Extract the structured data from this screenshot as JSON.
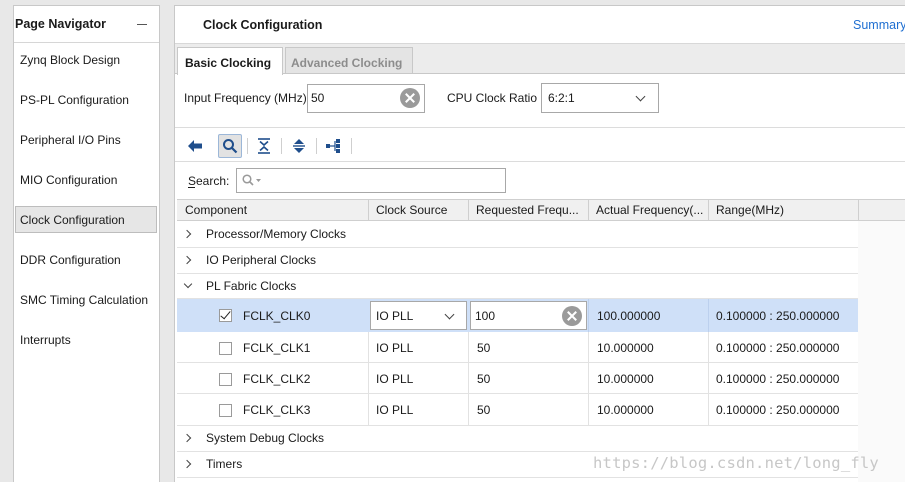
{
  "navigator": {
    "title": "Page Navigator",
    "items": [
      {
        "label": "Zynq Block Design"
      },
      {
        "label": "PS-PL Configuration"
      },
      {
        "label": "Peripheral I/O Pins"
      },
      {
        "label": "MIO Configuration"
      },
      {
        "label": "Clock Configuration",
        "selected": true
      },
      {
        "label": "DDR Configuration"
      },
      {
        "label": "SMC Timing Calculation"
      },
      {
        "label": "Interrupts"
      }
    ]
  },
  "main": {
    "title": "Clock Configuration",
    "summary_link": "Summary",
    "tabs": [
      {
        "label": "Basic Clocking",
        "active": true
      },
      {
        "label": "Advanced Clocking",
        "active": false
      }
    ],
    "input_frequency": {
      "label": "Input Frequency (MHz)",
      "value": "50"
    },
    "cpu_clock_ratio": {
      "label": "CPU Clock Ratio",
      "value": "6:2:1"
    },
    "search": {
      "label": "Search:",
      "placeholder": ""
    },
    "table": {
      "columns": [
        "Component",
        "Clock Source",
        "Requested Frequ...",
        "Actual Frequency(...",
        "Range(MHz)"
      ],
      "groups_top": [
        {
          "label": "Processor/Memory Clocks",
          "expanded": false
        },
        {
          "label": "IO Peripheral Clocks",
          "expanded": false
        },
        {
          "label": "PL Fabric Clocks",
          "expanded": true
        }
      ],
      "rows": [
        {
          "name": "FCLK_CLK0",
          "checked": true,
          "source": "IO PLL",
          "requested": "100",
          "actual": "100.000000",
          "range": "0.100000 : 250.000000"
        },
        {
          "name": "FCLK_CLK1",
          "checked": false,
          "source": "IO PLL",
          "requested": "50",
          "actual": "10.000000",
          "range": "0.100000 : 250.000000"
        },
        {
          "name": "FCLK_CLK2",
          "checked": false,
          "source": "IO PLL",
          "requested": "50",
          "actual": "10.000000",
          "range": "0.100000 : 250.000000"
        },
        {
          "name": "FCLK_CLK3",
          "checked": false,
          "source": "IO PLL",
          "requested": "50",
          "actual": "10.000000",
          "range": "0.100000 : 250.000000"
        }
      ],
      "groups_bottom": [
        {
          "label": "System Debug Clocks",
          "expanded": false
        },
        {
          "label": "Timers",
          "expanded": false
        }
      ]
    }
  },
  "watermark": "https://blog.csdn.net/long_fly",
  "colors": {
    "selection": "#cfe0f8",
    "link": "#1f6fd1",
    "icon_blue": "#1f4e8c"
  }
}
